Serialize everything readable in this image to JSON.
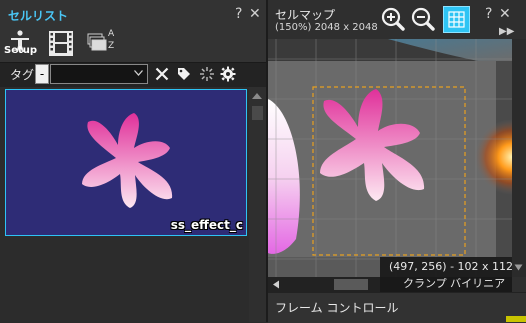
{
  "cell_list": {
    "title": "セルリスト",
    "help": "?",
    "close": "✕",
    "toolbar": {
      "setup_label": "Setup",
      "sort_label_top": "A",
      "sort_label_bottom": "Z"
    },
    "tag_filter": {
      "label": "タグ",
      "minus": "-",
      "selected": ""
    },
    "items": [
      {
        "name": "ss_effect_c"
      }
    ]
  },
  "cell_map": {
    "title": "セルマップ",
    "subtitle": "(150%) 2048 x 2048",
    "help": "?",
    "close": "✕",
    "menu": "▶▶",
    "coordinate": "(497, 256) - 102 x 112",
    "filter": "クランプ バイリニア",
    "grid_enabled": true
  },
  "frame_control": {
    "title": "フレーム コントロール"
  },
  "colors": {
    "accent": "#2ec4f4",
    "cell_bg": "#2e2c76",
    "petal_top": "#e0309a",
    "petal_bottom": "#fde8f2",
    "selection": "#e8a020"
  },
  "icons": [
    "setup-icon",
    "film-icon",
    "sort-icon",
    "clear-icon",
    "tag-icon",
    "burst-icon",
    "gear-icon",
    "zoom-in-icon",
    "zoom-out-icon",
    "grid-icon"
  ]
}
